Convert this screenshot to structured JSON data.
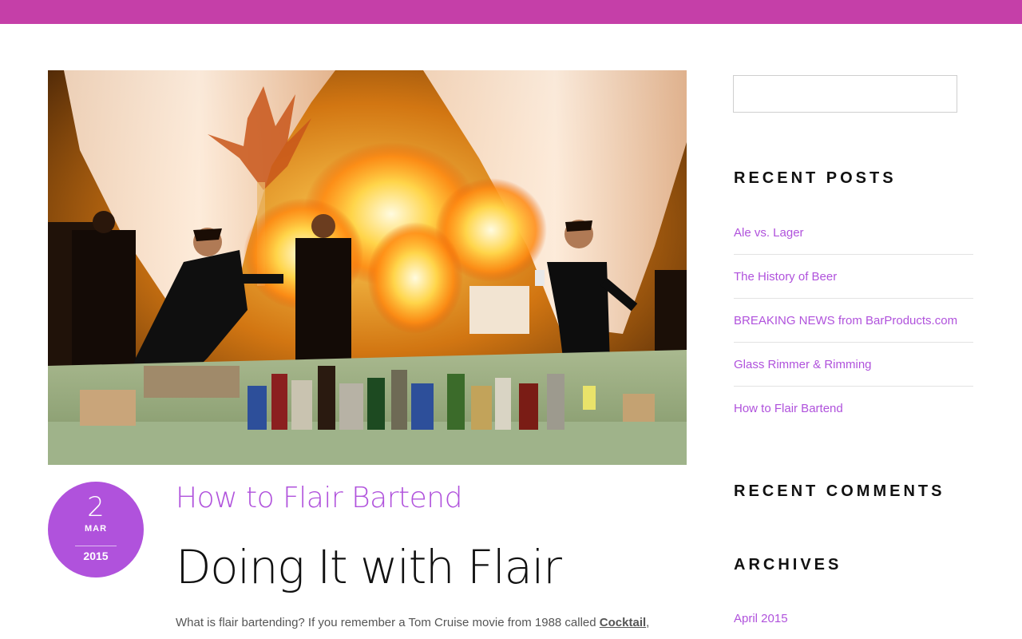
{
  "colors": {
    "top_bar": "#c53fa8",
    "accent": "#b052dc",
    "heading": "#111111",
    "body_text": "#555555"
  },
  "post": {
    "date": {
      "day": "2",
      "month": "MAR",
      "year": "2015"
    },
    "category_title": "How to Flair Bartend",
    "title": "Doing It with Flair",
    "excerpt_before": "What is flair bartending?  If you remember a Tom Cruise movie from 1988 called ",
    "excerpt_link": "Cocktail",
    "excerpt_after": ","
  },
  "sidebar": {
    "search": {
      "placeholder": "",
      "value": ""
    },
    "recent_posts": {
      "title": "RECENT POSTS",
      "items": [
        {
          "label": "Ale vs. Lager"
        },
        {
          "label": "The History of Beer"
        },
        {
          "label": "BREAKING NEWS from BarProducts.com"
        },
        {
          "label": "Glass Rimmer & Rimming"
        },
        {
          "label": "How to Flair Bartend"
        }
      ]
    },
    "recent_comments": {
      "title": "RECENT COMMENTS"
    },
    "archives": {
      "title": "ARCHIVES",
      "items": [
        {
          "label": "April 2015"
        }
      ]
    }
  }
}
